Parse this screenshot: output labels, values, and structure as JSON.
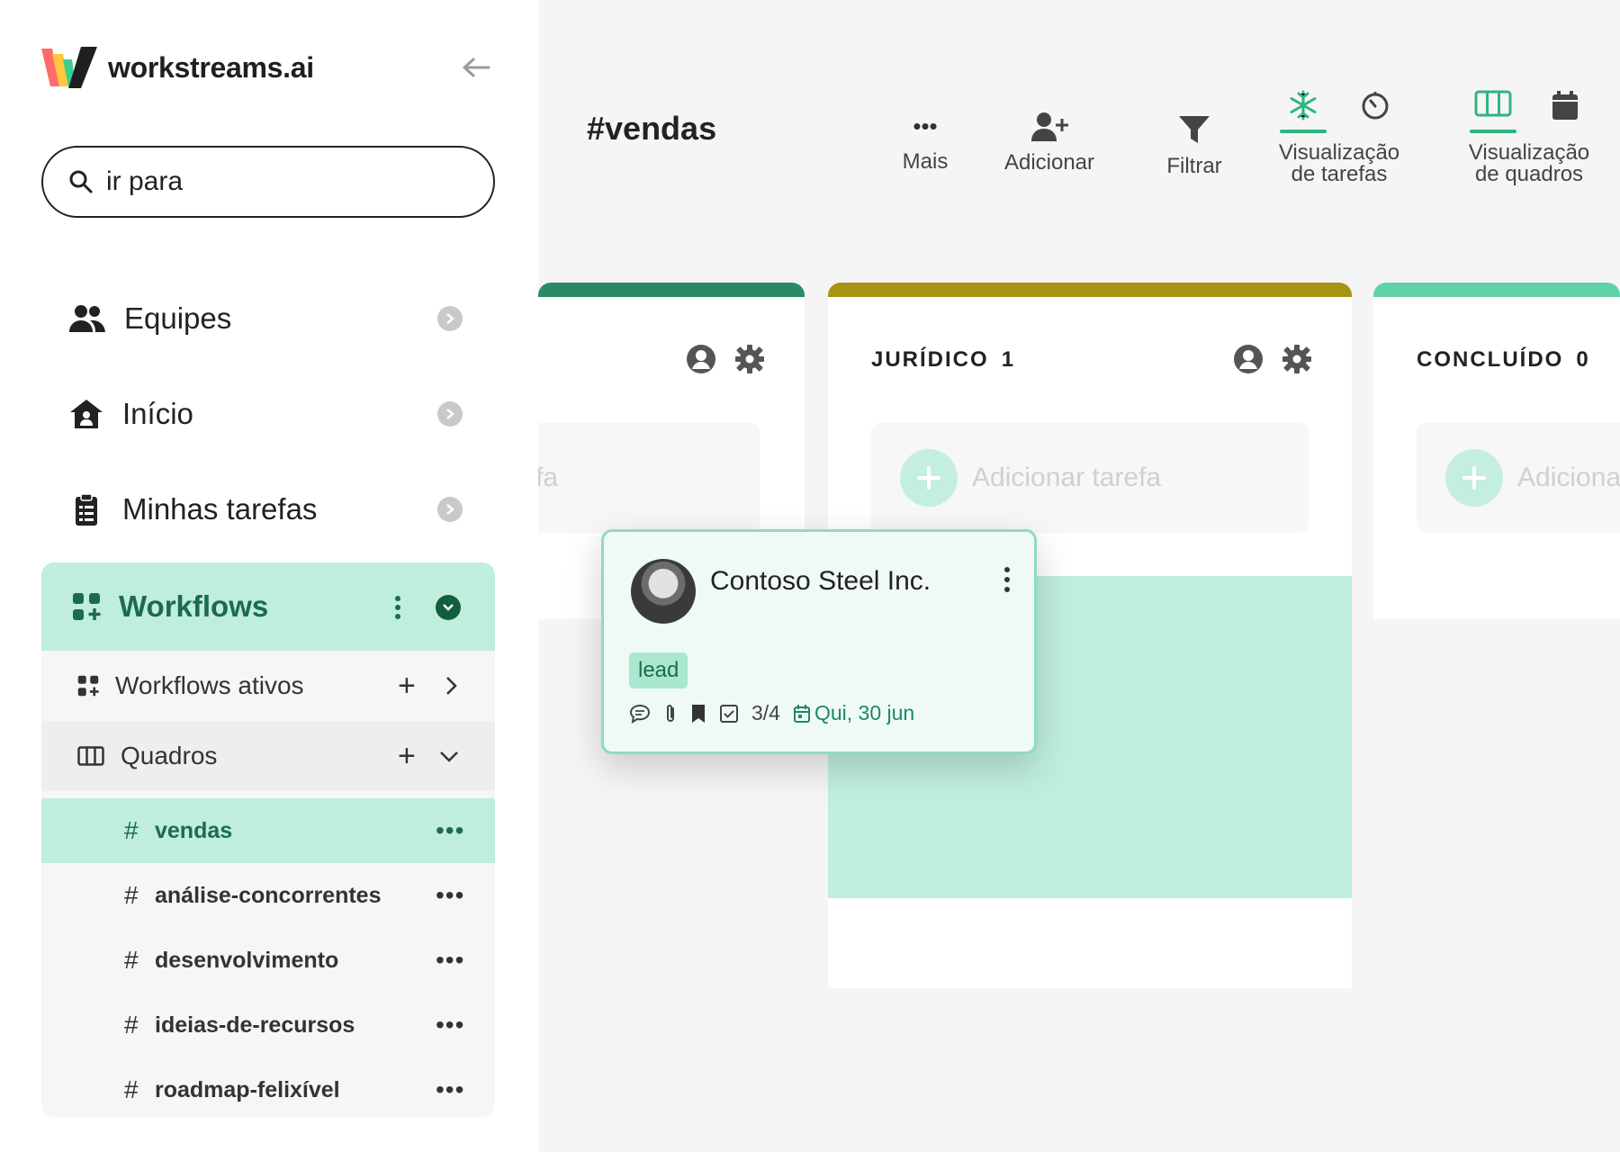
{
  "app": {
    "brand": "workstreams.ai"
  },
  "colors": {
    "accent": "#2fb57e",
    "accent_light": "#bfeedd",
    "accent_dark": "#1d6b4e",
    "col1_bar": "#2a8a66",
    "col2_bar": "#a89410",
    "col3_bar": "#5fd3a6"
  },
  "sidebar": {
    "search_placeholder": "ir para",
    "nav": [
      {
        "label": "Equipes",
        "icon": "users-icon"
      },
      {
        "label": "Início",
        "icon": "home-icon"
      },
      {
        "label": "Minhas tarefas",
        "icon": "clipboard-icon"
      }
    ],
    "workflows": {
      "label": "Workflows",
      "active_label": "Workflows ativos",
      "boards_label": "Quadros",
      "boards": [
        "vendas",
        "análise-concorrentes",
        "desenvolvimento",
        "ideias-de-recursos",
        "roadmap-felixível"
      ],
      "hash": "#",
      "more": "•••"
    }
  },
  "header": {
    "title": "#vendas",
    "tools": {
      "more": "Mais",
      "add": "Adicionar",
      "filter": "Filtrar"
    },
    "task_view": {
      "line1": "Visualização",
      "line2": "de tarefas"
    },
    "board_view": {
      "line1": "Visualização",
      "line2": "de quadros"
    },
    "more_dots": "•••"
  },
  "columns": [
    {
      "title": "",
      "count": "",
      "add_task": "Adicionar tarefa"
    },
    {
      "title": "JURÍDICO",
      "count": "1",
      "add_task": "Adicionar tarefa"
    },
    {
      "title": "CONCLUÍDO",
      "count": "0",
      "add_task": "Adicionar tarefa"
    }
  ],
  "card": {
    "title": "Contoso Steel Inc.",
    "tag": "lead",
    "checklist": "3/4",
    "due": "Qui, 30 jun"
  }
}
